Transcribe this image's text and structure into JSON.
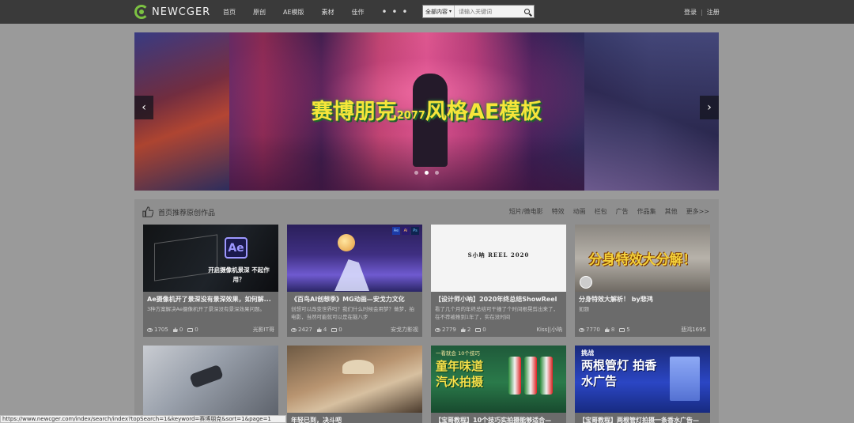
{
  "header": {
    "logo_text": "NEWCGER",
    "nav": [
      "首页",
      "原创",
      "AE模版",
      "素材",
      "佳作"
    ],
    "nav_more": "• • •",
    "search": {
      "scope": "全部内容",
      "placeholder": "请输入关键词"
    },
    "auth": {
      "login": "登录",
      "sep": "|",
      "register": "注册"
    }
  },
  "banner": {
    "title_pre": "赛博朋克",
    "title_num": "2077",
    "title_post": "风格AE模板",
    "arrow_left": "‹",
    "arrow_right": "›",
    "active_dot": 2,
    "dot_count": 3
  },
  "section": {
    "title": "首页推荐原创作品",
    "categories": [
      "短片/微电影",
      "特效",
      "动画",
      "栏包",
      "广告",
      "作品集",
      "其他",
      "更多>>"
    ]
  },
  "cards_row1": [
    {
      "title": "Ae摄像机开了景深没有景深效果，如何解...",
      "desc": "3种方案解决Ae摄像机开了景深没有景深效果问题。",
      "views": "1705",
      "likes": "0",
      "comments": "0",
      "author": "光影IT哥",
      "thumb_text": "开启摄像机景深 不起作用？",
      "thumb_badge": "Ae"
    },
    {
      "title": "《百鸟AI创想季》MG动画—安戈力文化",
      "desc": "创想可以改变世界吗？我们什么时候会用梦？做梦，拍电影，当然可能就可以是在脑八步",
      "views": "2427",
      "likes": "4",
      "comments": "0",
      "author": "安戈力影视",
      "thumb_badges": [
        "Ae",
        "Ai",
        "Ps"
      ]
    },
    {
      "title": "【设计师小呐】2020年终总结ShowReel",
      "desc": "看了几个月的年终总结可干撞了个时间根晃剪出来了，在不荐被推到1年了，实在没时间",
      "views": "2779",
      "likes": "2",
      "comments": "0",
      "author": "Kiss||小呐",
      "thumb_text": "S小呐 REEL 2020"
    },
    {
      "title": "分身特效大解析！ by悲鸿",
      "desc": "如题",
      "views": "7770",
      "likes": "8",
      "comments": "5",
      "author": "悲鸿1695",
      "thumb_text": "分身特效大分解！"
    }
  ],
  "cards_row2": [
    {
      "title": ""
    },
    {
      "title": "年轻已到，决斗吧"
    },
    {
      "title": "【宝哥教程】10个技巧实拍摄能够适合—",
      "thumb_text": "童年味道 汽水拍摄",
      "thumb_top": "一看就会 10个技巧"
    },
    {
      "title": "【宝哥教程】两根管灯拍摄一条香水广告—",
      "thumb_text": "两根管灯 拍香水广告",
      "thumb_top": "挑战"
    }
  ],
  "statusbar": "https://www.newcger.com/index/search/index?topSearch=1&keyword=赛博朋克&sort=1&page=1",
  "colors": {
    "accent": "#7cc242",
    "banner_title": "#f6e53a",
    "topbar": "#3a3a3a"
  }
}
